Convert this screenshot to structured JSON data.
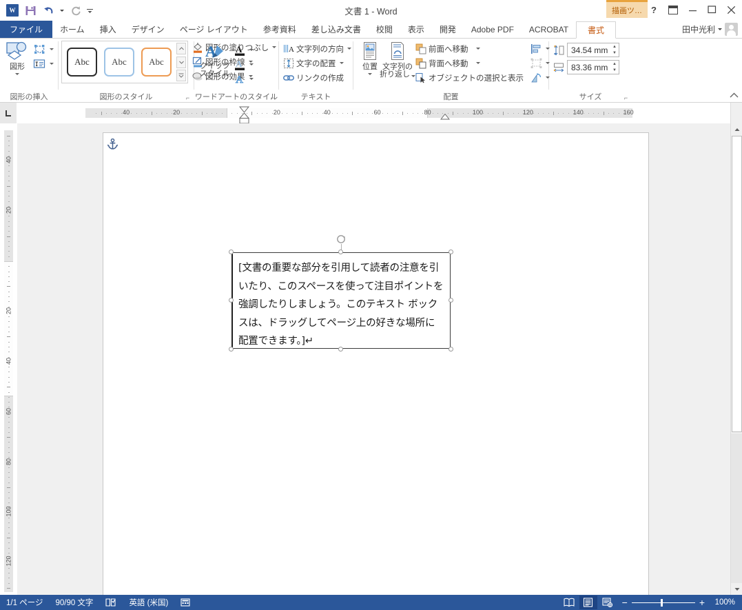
{
  "titlebar": {
    "document_title": "文書 1 - Word",
    "qat": [
      {
        "name": "word-logo-icon",
        "label": "W"
      },
      {
        "name": "save-icon",
        "label": "保存"
      },
      {
        "name": "undo-icon",
        "label": "元に戻す"
      },
      {
        "name": "redo-icon",
        "label": "やり直し"
      },
      {
        "name": "customize-qat-icon",
        "label": "クイック アクセス ツール バーのユーザー設定"
      }
    ],
    "contextual_tab_group": "描画ツ…",
    "window_buttons": {
      "help": "?",
      "ribbon_display": "▣",
      "minimize": "−",
      "restore": "❐",
      "close": "✕"
    }
  },
  "tabs": {
    "file": "ファイル",
    "items": [
      "ホーム",
      "挿入",
      "デザイン",
      "ページ レイアウト",
      "参考資料",
      "差し込み文書",
      "校閲",
      "表示",
      "開発",
      "Adobe PDF",
      "ACROBAT"
    ],
    "contextual_active": "書式",
    "user_name": "田中光利"
  },
  "ribbon": {
    "groups": [
      {
        "name": "insert-shapes",
        "label": "図形の挿入",
        "big_button": "図形",
        "small_buttons": [
          "図形の編集",
          "テキスト ボックスの描画"
        ]
      },
      {
        "name": "shape-styles",
        "label": "図形のスタイル",
        "gallery": [
          "Abc",
          "Abc",
          "Abc"
        ],
        "items": [
          "図形の塗りつぶし",
          "図形の枠線",
          "図形の効果"
        ]
      },
      {
        "name": "wordart-styles",
        "label": "ワードアートのスタイル",
        "big_button_line1": "クイック",
        "big_button_line2": "スタイル",
        "items": [
          "文字の塗りつぶし",
          "文字の輪郭",
          "文字の効果"
        ]
      },
      {
        "name": "text",
        "label": "テキスト",
        "items": [
          "文字列の方向",
          "文字の配置",
          "リンクの作成"
        ]
      },
      {
        "name": "arrange",
        "label": "配置",
        "big_buttons": [
          {
            "line1": "位置",
            "line2": ""
          },
          {
            "line1": "文字列の",
            "line2": "折り返し"
          }
        ],
        "items": [
          "前面へ移動",
          "背面へ移動",
          "オブジェクトの選択と表示"
        ],
        "icon_buttons": [
          "配置",
          "グループ化",
          "回転"
        ]
      },
      {
        "name": "size",
        "label": "サイズ",
        "height_value": "34.54 mm",
        "width_value": "83.36 mm"
      }
    ],
    "collapse_label": "リボンを折りたたむ"
  },
  "ruler": {
    "tab_selector": "L",
    "h_numbers": [
      "40",
      "20",
      "20",
      "40",
      "60",
      "80",
      "100",
      "120",
      "140",
      "160"
    ],
    "v_numbers": [
      "40",
      "20",
      "20",
      "40",
      "60",
      "80",
      "100",
      "120"
    ]
  },
  "document": {
    "anchor_label": "アンカー",
    "textbox_text": "[文書の重要な部分を引用して読者の注意を引いたり、このスペースを使って注目ポイントを強調したりしましょう。このテキスト ボックスは、ドラッグしてページ上の好きな場所に配置できます。]↵"
  },
  "statusbar": {
    "page_info": "1/1 ページ",
    "word_count": "90/90 文字",
    "proofing_icon": "proofing-icon",
    "language": "英語 (米国)",
    "macro_icon": "macro-record-icon",
    "views": [
      {
        "name": "read-mode-view-button",
        "label": "閲覧モード",
        "active": false
      },
      {
        "name": "print-layout-view-button",
        "label": "印刷レイアウト",
        "active": true
      },
      {
        "name": "web-layout-view-button",
        "label": "Web レイアウト",
        "active": false
      }
    ],
    "zoom_out": "−",
    "zoom_in": "+",
    "zoom_level": "100%"
  },
  "colors": {
    "word_blue": "#2b579a",
    "contextual_orange": "#e8a33d",
    "contextual_text": "#c55a11",
    "ribbon_border": "#d4d4d4"
  }
}
